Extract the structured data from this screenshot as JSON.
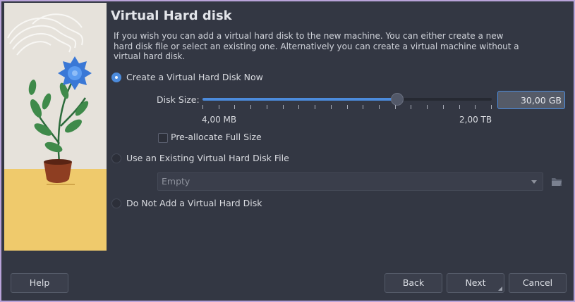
{
  "page": {
    "title": "Virtual Hard disk",
    "description": "If you wish you can add a virtual hard disk to the new machine. You can either create a new hard disk file or select an existing one. Alternatively you can create a virtual machine without a virtual hard disk."
  },
  "options": {
    "create_now": {
      "label": "Create a Virtual Hard Disk Now",
      "checked": true
    },
    "use_existing": {
      "label": "Use an Existing Virtual Hard Disk File",
      "checked": false
    },
    "do_not_add": {
      "label": "Do Not Add a Virtual Hard Disk",
      "checked": false
    }
  },
  "disk_size": {
    "label": "Disk Size:",
    "value": "30,00 GB",
    "min_label": "4,00 MB",
    "max_label": "2,00 TB",
    "slider_fraction": 0.67,
    "tick_count": 19
  },
  "preallocate": {
    "label": "Pre-allocate Full Size",
    "checked": false
  },
  "existing_file": {
    "value": "Empty"
  },
  "buttons": {
    "help": "Help",
    "back": "Back",
    "next": "Next",
    "cancel": "Cancel"
  },
  "colors": {
    "accent": "#4c8bdc",
    "background": "#333743",
    "window_border": "#b9a3d9"
  },
  "icons": {
    "folder": "folder-open-icon",
    "combo_arrow": "chevron-down-icon"
  }
}
